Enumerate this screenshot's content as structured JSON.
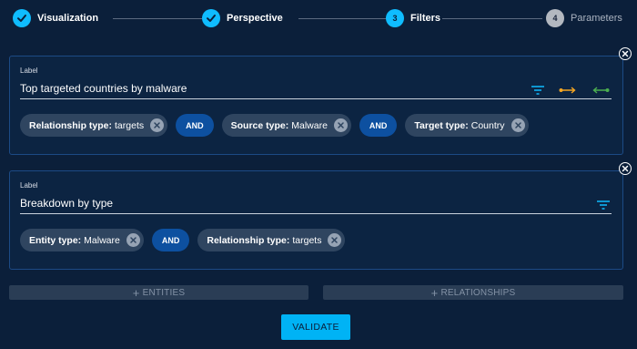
{
  "stepper": {
    "steps": [
      {
        "label": "Visualization",
        "state": "done",
        "number": ""
      },
      {
        "label": "Perspective",
        "state": "done",
        "number": ""
      },
      {
        "label": "Filters",
        "state": "active",
        "number": "3"
      },
      {
        "label": "Parameters",
        "state": "todo",
        "number": "4"
      }
    ]
  },
  "filters": [
    {
      "label_caption": "Label",
      "label_value": "Top targeted countries by malware",
      "chips": [
        {
          "key": "Relationship type:",
          "value": "targets"
        },
        {
          "key": "Source type:",
          "value": "Malware"
        },
        {
          "key": "Target type:",
          "value": "Country"
        }
      ],
      "operator": "AND"
    },
    {
      "label_caption": "Label",
      "label_value": "Breakdown by type",
      "chips": [
        {
          "key": "Entity type:",
          "value": "Malware"
        },
        {
          "key": "Relationship type:",
          "value": "targets"
        }
      ],
      "operator": "AND"
    }
  ],
  "actions": {
    "add_entities": "ENTITIES",
    "add_relationships": "RELATIONSHIPS",
    "plus": "+",
    "validate": "VALIDATE"
  },
  "colors": {
    "background": "#0b1f3a",
    "accent": "#0fbcff",
    "and_chip": "#0d50a0",
    "filter_chip": "#2f4560",
    "source_arrow": "#f5a623",
    "target_arrow": "#4caf50"
  },
  "icons": {
    "step_done": "check-icon",
    "remove_filter": "close-circle-icon",
    "chip_remove": "close-icon",
    "filter": "filter-icon",
    "from": "arrow-from-icon",
    "to": "arrow-to-icon"
  }
}
